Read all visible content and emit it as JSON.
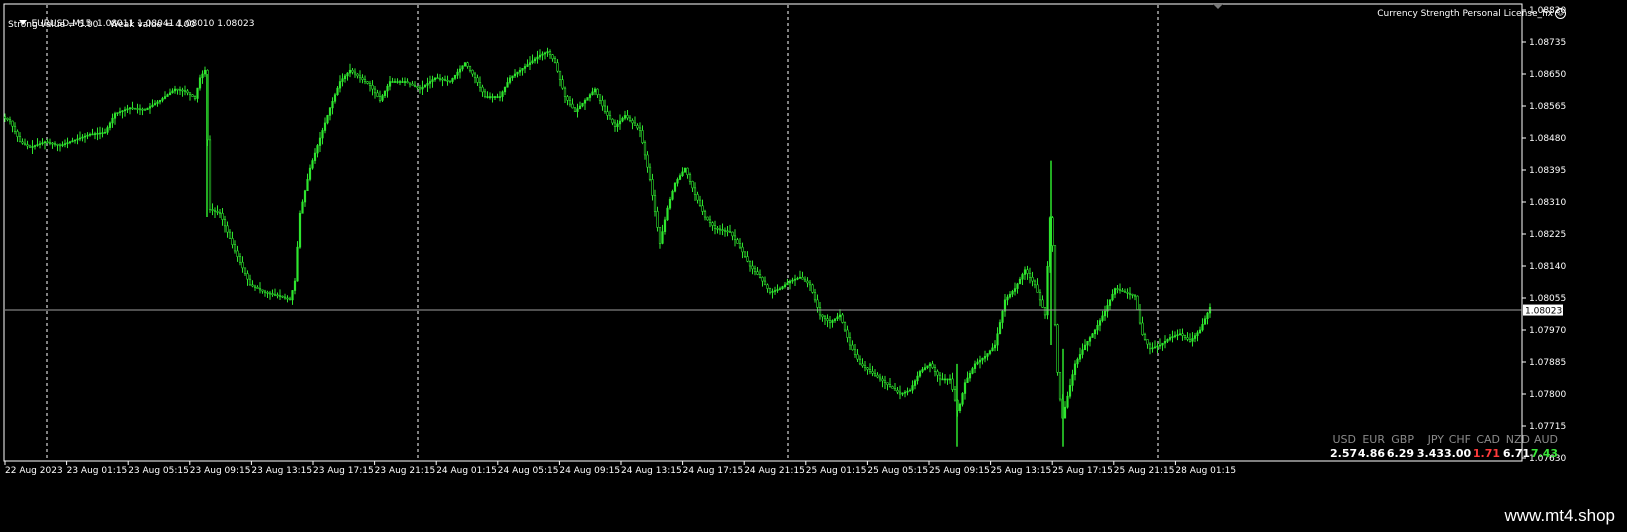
{
  "header": {
    "symbol_info": "EURUSD,M15  1.08011 1.08041 1.08010 1.08023",
    "strength_info": "Strong value = 5.00    Weak value = 4.00",
    "license_text": "Currency Strength Personal License_fix"
  },
  "price_axis": {
    "labels": [
      "1.08820",
      "1.08735",
      "1.08650",
      "1.08565",
      "1.08480",
      "1.08395",
      "1.08310",
      "1.08225",
      "1.08140",
      "1.08055",
      "1.07970",
      "1.07885",
      "1.07800",
      "1.07715",
      "1.07630"
    ],
    "current_price": "1.08023"
  },
  "time_axis": {
    "labels": [
      "22 Aug 2023",
      "23 Aug 01:15",
      "23 Aug 05:15",
      "23 Aug 09:15",
      "23 Aug 13:15",
      "23 Aug 17:15",
      "23 Aug 21:15",
      "24 Aug 01:15",
      "24 Aug 05:15",
      "24 Aug 09:15",
      "24 Aug 13:15",
      "24 Aug 17:15",
      "24 Aug 21:15",
      "25 Aug 01:15",
      "25 Aug 05:15",
      "25 Aug 09:15",
      "25 Aug 13:15",
      "25 Aug 17:15",
      "25 Aug 21:15",
      "28 Aug 01:15"
    ]
  },
  "currency_strength": [
    {
      "code": "USD",
      "value": "2.57",
      "color": "#ffffff"
    },
    {
      "code": "EUR",
      "value": "4.86",
      "color": "#ffffff"
    },
    {
      "code": "GBP",
      "value": "6.29",
      "color": "#ffffff"
    },
    {
      "code": "JPY",
      "value": "3.43",
      "color": "#ffffff"
    },
    {
      "code": "CHF",
      "value": "3.00",
      "color": "#ffffff"
    },
    {
      "code": "CAD",
      "value": "1.71",
      "color": "#ff3b3b"
    },
    {
      "code": "NZD",
      "value": "6.71",
      "color": "#ffffff"
    },
    {
      "code": "AUD",
      "value": "7.43",
      "color": "#39e639"
    }
  ],
  "colors": {
    "candle": "#2ee62e",
    "grid": "#ffffff",
    "bid_line": "#a0a0a0",
    "background": "#000000"
  },
  "footer": {
    "brand": "www.mt4.shop"
  },
  "price_path": [
    [
      0,
      1.0854
    ],
    [
      10,
      1.08525
    ],
    [
      20,
      1.0847
    ],
    [
      30,
      1.08455
    ],
    [
      45,
      1.0847
    ],
    [
      60,
      1.0846
    ],
    [
      75,
      1.08475
    ],
    [
      90,
      1.0849
    ],
    [
      105,
      1.08495
    ],
    [
      115,
      1.08545
    ],
    [
      130,
      1.0856
    ],
    [
      145,
      1.08555
    ],
    [
      160,
      1.0858
    ],
    [
      175,
      1.0861
    ],
    [
      185,
      1.08605
    ],
    [
      195,
      1.08585
    ],
    [
      200,
      1.0864
    ],
    [
      205,
      1.0866
    ],
    [
      210,
      1.0829
    ],
    [
      220,
      1.0828
    ],
    [
      235,
      1.0818
    ],
    [
      250,
      1.0809
    ],
    [
      265,
      1.0807
    ],
    [
      280,
      1.0806
    ],
    [
      290,
      1.0805
    ],
    [
      295,
      1.081
    ],
    [
      300,
      1.0828
    ],
    [
      310,
      1.084
    ],
    [
      320,
      1.0848
    ],
    [
      330,
      1.0856
    ],
    [
      340,
      1.0863
    ],
    [
      350,
      1.0866
    ],
    [
      360,
      1.0864
    ],
    [
      370,
      1.0862
    ],
    [
      380,
      1.0858
    ],
    [
      390,
      1.0863
    ],
    [
      405,
      1.0863
    ],
    [
      420,
      1.0861
    ],
    [
      435,
      1.0864
    ],
    [
      450,
      1.0863
    ],
    [
      465,
      1.0868
    ],
    [
      475,
      1.0864
    ],
    [
      485,
      1.0859
    ],
    [
      500,
      1.0859
    ],
    [
      510,
      1.0864
    ],
    [
      520,
      1.0866
    ],
    [
      530,
      1.0868
    ],
    [
      540,
      1.087
    ],
    [
      548,
      1.0871
    ],
    [
      555,
      1.0868
    ],
    [
      565,
      1.0859
    ],
    [
      575,
      1.0855
    ],
    [
      585,
      1.0858
    ],
    [
      595,
      1.0861
    ],
    [
      605,
      1.0855
    ],
    [
      615,
      1.0851
    ],
    [
      625,
      1.0854
    ],
    [
      640,
      1.085
    ],
    [
      650,
      1.0837
    ],
    [
      660,
      1.082
    ],
    [
      668,
      1.083
    ],
    [
      675,
      1.0836
    ],
    [
      685,
      1.084
    ],
    [
      695,
      1.0833
    ],
    [
      705,
      1.0827
    ],
    [
      715,
      1.0824
    ],
    [
      730,
      1.0823
    ],
    [
      740,
      1.0819
    ],
    [
      750,
      1.0814
    ],
    [
      760,
      1.0811
    ],
    [
      770,
      1.0807
    ],
    [
      780,
      1.0808
    ],
    [
      790,
      1.081
    ],
    [
      800,
      1.0811
    ],
    [
      810,
      1.0809
    ],
    [
      820,
      1.0801
    ],
    [
      830,
      1.0799
    ],
    [
      840,
      1.0801
    ],
    [
      850,
      1.0793
    ],
    [
      860,
      1.0788
    ],
    [
      870,
      1.0786
    ],
    [
      880,
      1.0784
    ],
    [
      890,
      1.0782
    ],
    [
      900,
      1.078
    ],
    [
      910,
      1.0781
    ],
    [
      920,
      1.0786
    ],
    [
      930,
      1.0788
    ],
    [
      940,
      1.0784
    ],
    [
      950,
      1.0784
    ],
    [
      958,
      1.0775
    ],
    [
      965,
      1.0783
    ],
    [
      975,
      1.0788
    ],
    [
      985,
      1.079
    ],
    [
      995,
      1.0793
    ],
    [
      1005,
      1.0805
    ],
    [
      1015,
      1.0808
    ],
    [
      1025,
      1.0813
    ],
    [
      1035,
      1.0809
    ],
    [
      1045,
      1.0801
    ],
    [
      1051,
      1.0832
    ],
    [
      1056,
      1.079
    ],
    [
      1062,
      1.0773
    ],
    [
      1068,
      1.078
    ],
    [
      1075,
      1.0788
    ],
    [
      1085,
      1.0793
    ],
    [
      1095,
      1.0797
    ],
    [
      1105,
      1.0802
    ],
    [
      1115,
      1.0808
    ],
    [
      1125,
      1.0807
    ],
    [
      1135,
      1.0806
    ],
    [
      1142,
      1.0796
    ],
    [
      1150,
      1.0792
    ],
    [
      1160,
      1.0793
    ],
    [
      1170,
      1.0795
    ],
    [
      1180,
      1.0796
    ],
    [
      1190,
      1.0794
    ],
    [
      1200,
      1.0797
    ],
    [
      1210,
      1.0803
    ]
  ]
}
